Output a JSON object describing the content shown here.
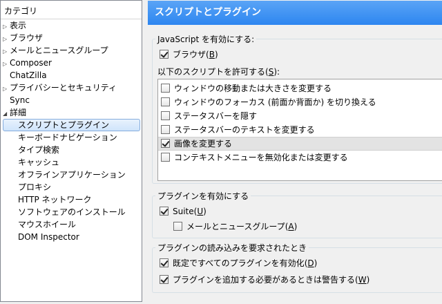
{
  "sidebar": {
    "header": "カテゴリ",
    "items": [
      {
        "label": "表示",
        "expandable": true,
        "level": 0
      },
      {
        "label": "ブラウザ",
        "expandable": true,
        "level": 0
      },
      {
        "label": "メールとニュースグループ",
        "expandable": true,
        "level": 0
      },
      {
        "label": "Composer",
        "expandable": true,
        "level": 0
      },
      {
        "label": "ChatZilla",
        "expandable": false,
        "level": 0
      },
      {
        "label": "プライバシーとセキュリティ",
        "expandable": true,
        "level": 0
      },
      {
        "label": "Sync",
        "expandable": false,
        "level": 0
      },
      {
        "label": "詳細",
        "expandable": true,
        "expanded": true,
        "level": 0
      },
      {
        "label": "スクリプトとプラグイン",
        "level": 1,
        "selected": true
      },
      {
        "label": "キーボードナビゲーション",
        "level": 1
      },
      {
        "label": "タイプ検索",
        "level": 1
      },
      {
        "label": "キャッシュ",
        "level": 1
      },
      {
        "label": "オフラインアプリケーション",
        "level": 1
      },
      {
        "label": "プロキシ",
        "level": 1
      },
      {
        "label": "HTTP ネットワーク",
        "level": 1
      },
      {
        "label": "ソフトウェアのインストール",
        "level": 1
      },
      {
        "label": "マウスホイール",
        "level": 1
      },
      {
        "label": "DOM Inspector",
        "level": 1
      }
    ]
  },
  "pane": {
    "title": "スクリプトとプラグイン",
    "javascript": {
      "caption": "JavaScript を有効にする:",
      "browser": {
        "label": "ブラウザ",
        "accesskey": "B",
        "checked": true
      },
      "allow_label": "以下のスクリプトを許可する",
      "allow_accesskey": "S",
      "options": [
        {
          "label": "ウィンドウの移動または大きさを変更する",
          "checked": false
        },
        {
          "label": "ウィンドウのフォーカス (前面か背面か) を切り換える",
          "checked": false
        },
        {
          "label": "ステータスバーを隠す",
          "checked": false
        },
        {
          "label": "ステータスバーのテキストを変更する",
          "checked": false
        },
        {
          "label": "画像を変更する",
          "checked": true,
          "selected": true
        },
        {
          "label": "コンテキストメニューを無効化または変更する",
          "checked": false
        }
      ]
    },
    "plugins": {
      "caption": "プラグインを有効にする",
      "suite": {
        "label": "Suite",
        "accesskey": "U",
        "checked": true
      },
      "mail": {
        "label": "メールとニュースグループ",
        "accesskey": "A",
        "checked": false
      }
    },
    "plugin_load": {
      "caption": "プラグインの読み込みを要求されたとき",
      "enable_all": {
        "label": "既定ですべてのプラグインを有効化",
        "accesskey": "D",
        "checked": true
      },
      "warn": {
        "label": "プラグインを追加する必要があるときは警告する",
        "accesskey": "W",
        "checked": true
      }
    }
  },
  "colors": {
    "title_bar": "#3f95f3",
    "selection": "#cfe4fb"
  }
}
